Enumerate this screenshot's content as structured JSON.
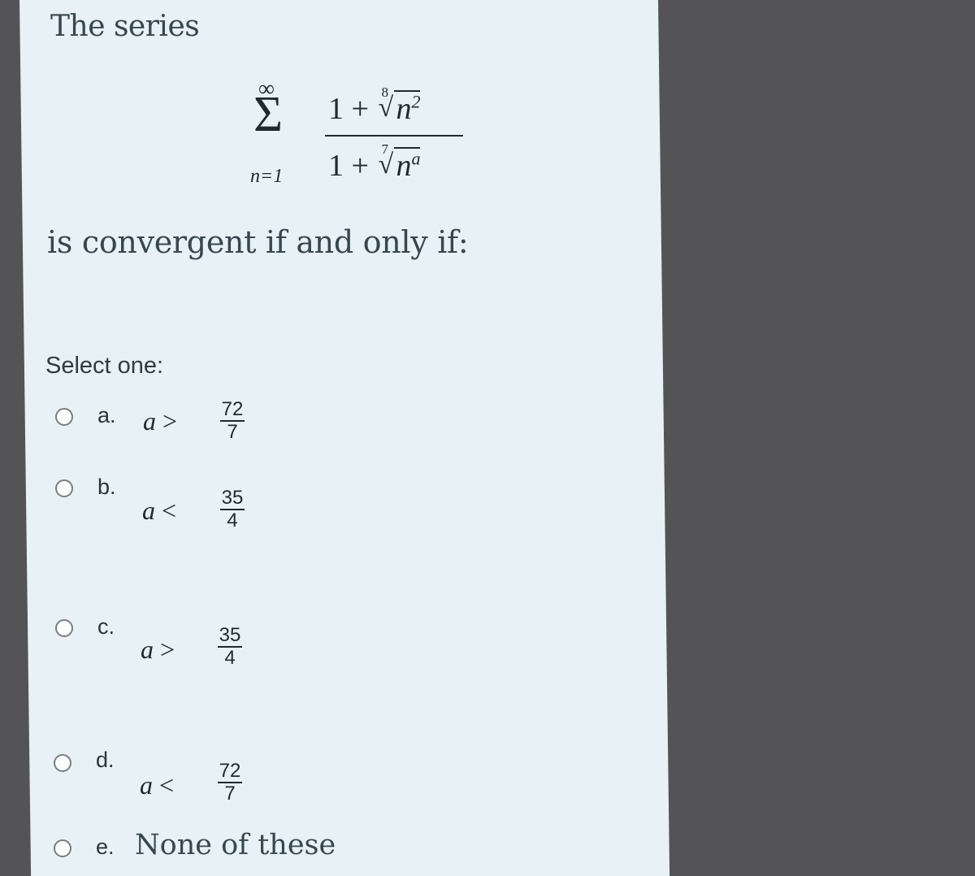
{
  "question": {
    "intro": "The series",
    "series": {
      "sum_symbol": "Σ",
      "upper_limit": "∞",
      "lower_limit": "n=1",
      "numerator": {
        "constant": "1 +",
        "root_index": "8",
        "radical_sign": "√",
        "base": "n",
        "exponent": "2"
      },
      "denominator": {
        "constant": "1 +",
        "root_index": "7",
        "radical_sign": "√",
        "base": "n",
        "exponent": "a"
      }
    },
    "condition_text": "is convergent if and only if:"
  },
  "select_label": "Select one:",
  "options": [
    {
      "letter": "a.",
      "var": "a",
      "op": ">",
      "numerator": "72",
      "denominator": "7"
    },
    {
      "letter": "b.",
      "var": "a",
      "op": "<",
      "numerator": "35",
      "denominator": "4"
    },
    {
      "letter": "c.",
      "var": "a",
      "op": ">",
      "numerator": "35",
      "denominator": "4"
    },
    {
      "letter": "d.",
      "var": "a",
      "op": "<",
      "numerator": "72",
      "denominator": "7"
    },
    {
      "letter": "e.",
      "text": "None of these"
    }
  ],
  "colors": {
    "panel_bg": "#e8f1f5",
    "outer_bg": "#545456",
    "text": "#37474f"
  }
}
